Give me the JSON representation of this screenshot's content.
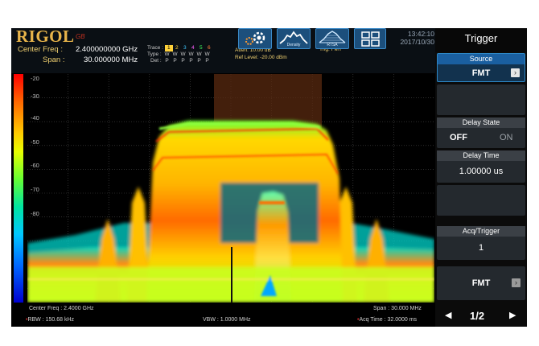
{
  "brand": {
    "logo": "RIGOL",
    "sub": "GB"
  },
  "header": {
    "center_freq_label": "Center Freq :",
    "center_freq_value": "2.400000000 GHz",
    "span_label": "Span :",
    "span_value": "30.000000 MHz",
    "trace_label": "Trace :",
    "trace_numbers": [
      "1",
      "2",
      "3",
      "4",
      "5",
      "6"
    ],
    "type_label": "Type :",
    "type_values": [
      "W",
      "W",
      "W",
      "W",
      "W",
      "W"
    ],
    "det_label": "Det :",
    "det_values": [
      "P",
      "P",
      "P",
      "P",
      "P",
      "P"
    ],
    "atten": "Atten: 10.00 dB",
    "ref_level": "Ref Level: -20.00 dBm",
    "trig_status": "Trig: FMT",
    "mode_buttons": [
      {
        "name": "settings",
        "label": ""
      },
      {
        "name": "density",
        "label": "Density"
      },
      {
        "name": "rtsa",
        "label": "RTSA"
      },
      {
        "name": "layout",
        "label": ""
      }
    ],
    "time": "13:42:10",
    "date": "2017/10/30"
  },
  "panel": {
    "title": "Trigger",
    "source_label": "Source",
    "source_value": "FMT",
    "delay_state_label": "Delay State",
    "delay_state_off": "OFF",
    "delay_state_on": "ON",
    "delay_time_label": "Delay Time",
    "delay_time_value": "1.00000 us",
    "acq_trigger_label": "Acq/Trigger",
    "acq_trigger_value": "1",
    "fmt_label": "FMT",
    "page": "1/2"
  },
  "plot": {
    "y_ticks": [
      "-20",
      "-30",
      "-40",
      "-50",
      "-60",
      "-70",
      "-80"
    ],
    "colors": {
      "hot": "#ff2a00",
      "warm": "#ffd800",
      "mid": "#70ff30",
      "cool": "#00e0c8",
      "cold": "#0050ff"
    }
  },
  "footer": {
    "center_freq": "Center Freq : 2.4000 GHz",
    "span": "Span : 30.000 MHz",
    "rbw": "RBW : 150.68 kHz",
    "vbw": "VBW : 1.0000 MHz",
    "acq_time": "Acq Time : 32.0000 ms"
  }
}
